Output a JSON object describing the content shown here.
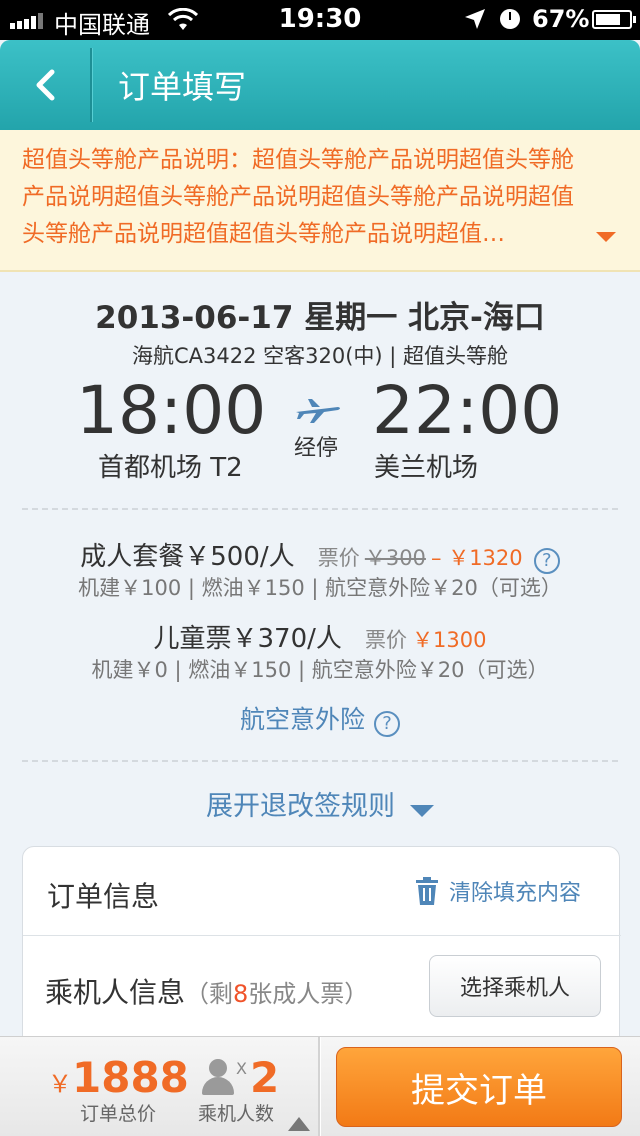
{
  "status_bar": {
    "carrier": "中国联通",
    "time": "19:30",
    "battery": "67%"
  },
  "nav": {
    "title": "订单填写",
    "back_icon": "chevron-left-icon"
  },
  "notice": {
    "text": "超值头等舱产品说明：超值头等舱产品说明超值头等舱产品说明超值头等舱产品说明超值头等舱产品说明超值头等舱产品说明超值超值头等舱产品说明超值…"
  },
  "flight": {
    "header": "2013-06-17 星期一  北京-海口",
    "subinfo": "海航CA3422  空客320(中) | 超值头等舱",
    "dep_time": "18:00",
    "arr_time": "22:00",
    "dep_airport": "首都机场 T2",
    "arr_airport": "美兰机场",
    "stop_label": "经停"
  },
  "prices": {
    "adult_main": "成人套餐￥500/人",
    "adult_price_label": "票价",
    "adult_original": "￥300",
    "adult_final": "– ￥1320",
    "adult_fees": "机建￥100 | 燃油￥150 | 航空意外险￥20（可选）",
    "child_main": "儿童票￥370/人",
    "child_price_label": "票价",
    "child_price": "￥1300",
    "child_fees": "机建￥0 | 燃油￥150 | 航空意外险￥20（可选）",
    "insurance_link": "航空意外险",
    "help_glyph": "?"
  },
  "rules_toggle": "展开退改签规则",
  "order_info": {
    "title": "订单信息",
    "clear_label": "清除填充内容",
    "passenger_label": "乘机人信息",
    "passenger_sub_prefix": "（剩",
    "passenger_remaining": "8",
    "passenger_sub_suffix": "张成人票）",
    "choose_button": "选择乘机人"
  },
  "bottom_bar": {
    "currency": "￥",
    "total": "1888",
    "total_label": "订单总价",
    "times": "X",
    "passenger_count": "2",
    "passenger_count_label": "乘机人数",
    "submit": "提交订单"
  },
  "colors": {
    "teal": "#2fb3b9",
    "orange": "#f06b26",
    "link_blue": "#4f86b8"
  }
}
